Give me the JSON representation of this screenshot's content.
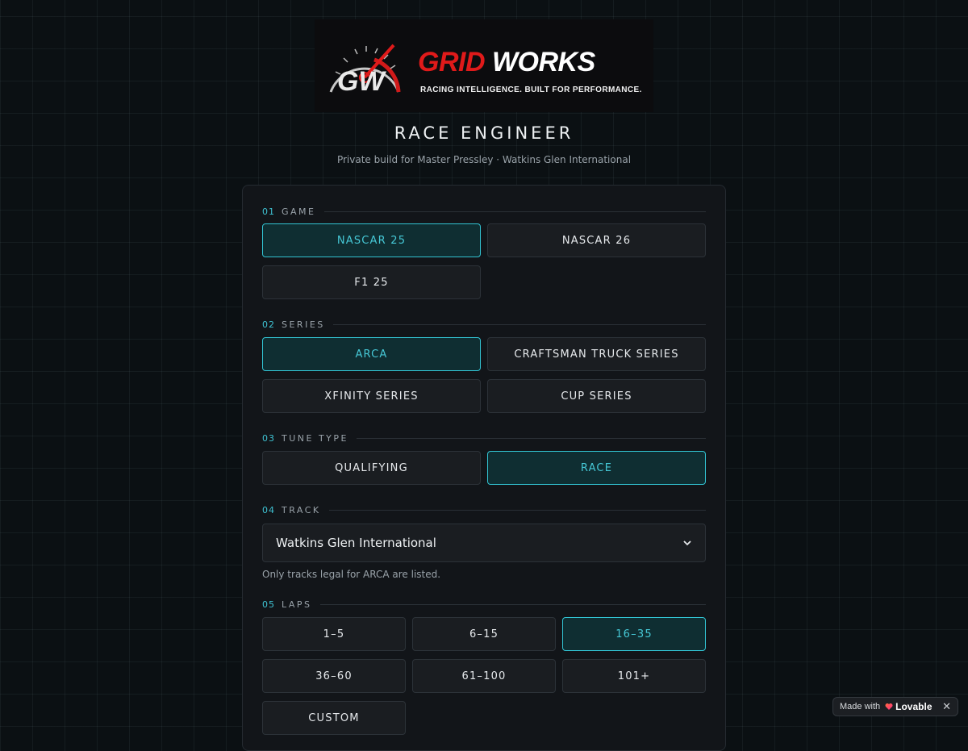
{
  "logo": {
    "brand_red": "GRID",
    "brand_white": "WORKS",
    "tagline": "RACING INTELLIGENCE. BUILT FOR PERFORMANCE.",
    "monogram": "GW",
    "colors": {
      "red": "#e01a1a",
      "white": "#ffffff"
    }
  },
  "page": {
    "title": "RACE ENGINEER",
    "subtitle": "Private build for Master Pressley · Watkins Glen International"
  },
  "sections": {
    "game": {
      "num": "01",
      "label": "GAME",
      "options": [
        "NASCAR 25",
        "NASCAR 26",
        "F1 25"
      ],
      "selected": "NASCAR 25"
    },
    "series": {
      "num": "02",
      "label": "SERIES",
      "options": [
        "ARCA",
        "CRAFTSMAN TRUCK SERIES",
        "XFINITY SERIES",
        "CUP SERIES"
      ],
      "selected": "ARCA"
    },
    "tune": {
      "num": "03",
      "label": "TUNE TYPE",
      "options": [
        "QUALIFYING",
        "RACE"
      ],
      "selected": "RACE"
    },
    "track": {
      "num": "04",
      "label": "TRACK",
      "value": "Watkins Glen International",
      "hint": "Only tracks legal for ARCA are listed."
    },
    "laps": {
      "num": "05",
      "label": "LAPS",
      "options": [
        "1–5",
        "6–15",
        "16–35",
        "36–60",
        "61–100",
        "101+",
        "CUSTOM"
      ],
      "selected": "16–35"
    }
  },
  "badge": {
    "made_with": "Made with",
    "brand": "Lovable",
    "close": "✕"
  },
  "theme": {
    "accent": "#32c3d2",
    "selected_bg": "#0f2e32",
    "panel_bg": "#121519"
  }
}
